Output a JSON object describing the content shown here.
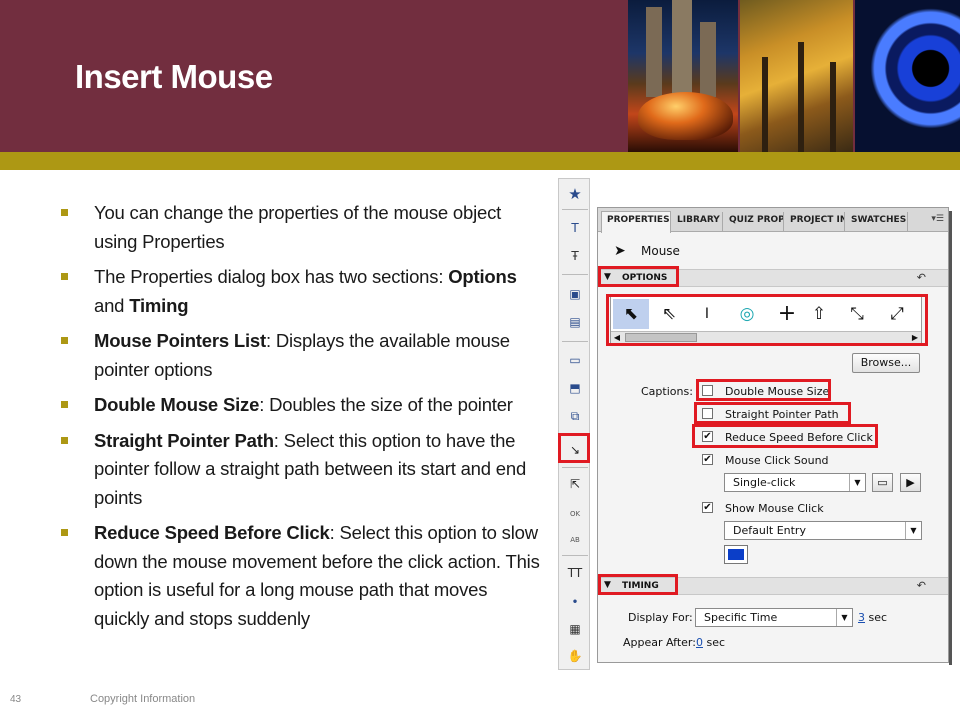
{
  "slide": {
    "title": "Insert Mouse",
    "number": "43",
    "copyright": "Copyright Information"
  },
  "bullets": [
    {
      "bold": "",
      "text": "You can change the properties of the mouse object using Properties"
    },
    {
      "bold": "",
      "text": "The Properties dialog box has two sections: ",
      "b1": "Options",
      "mid": " and ",
      "b2": "Timing"
    },
    {
      "bold": "Mouse Pointers List",
      "text": ": Displays the available mouse pointer options"
    },
    {
      "bold": "Double Mouse Size",
      "text": ": Doubles the size of the pointer"
    },
    {
      "bold": "Straight Pointer Path",
      "text": ": Select this option to have the pointer follow a straight path between its start and end points"
    },
    {
      "bold": "Reduce Speed Before Click",
      "text": ": Select this option to slow down the mouse movement before the click action. This option is useful for a long mouse path that moves quickly and stops suddenly"
    }
  ],
  "panel": {
    "tabs": [
      "PROPERTIES",
      "LIBRARY",
      "QUIZ PROP",
      "PROJECT IN",
      "SWATCHES"
    ],
    "object_name": "Mouse",
    "options_label": "OPTIONS",
    "timing_label": "TIMING",
    "browse_label": "Browse...",
    "captions_label": "Captions:",
    "checkboxes": [
      {
        "label": "Double Mouse Size",
        "checked": false
      },
      {
        "label": "Straight Pointer Path",
        "checked": false
      },
      {
        "label": "Reduce Speed Before Click",
        "checked": true
      },
      {
        "label": "Mouse Click Sound",
        "checked": true
      },
      {
        "label": "Show Mouse Click",
        "checked": true
      }
    ],
    "sound_select": "Single-click",
    "click_select": "Default Entry",
    "click_color": "#0b3ec8",
    "display_for_label": "Display For:",
    "display_for_value": "Specific Time",
    "display_for_secs": "3",
    "appear_after_label": "Appear After:",
    "appear_after_secs": "0",
    "sec_unit": "sec"
  },
  "colors": {
    "header": "#722e3f",
    "stripe": "#ad9814",
    "highlight": "#e01a22"
  }
}
